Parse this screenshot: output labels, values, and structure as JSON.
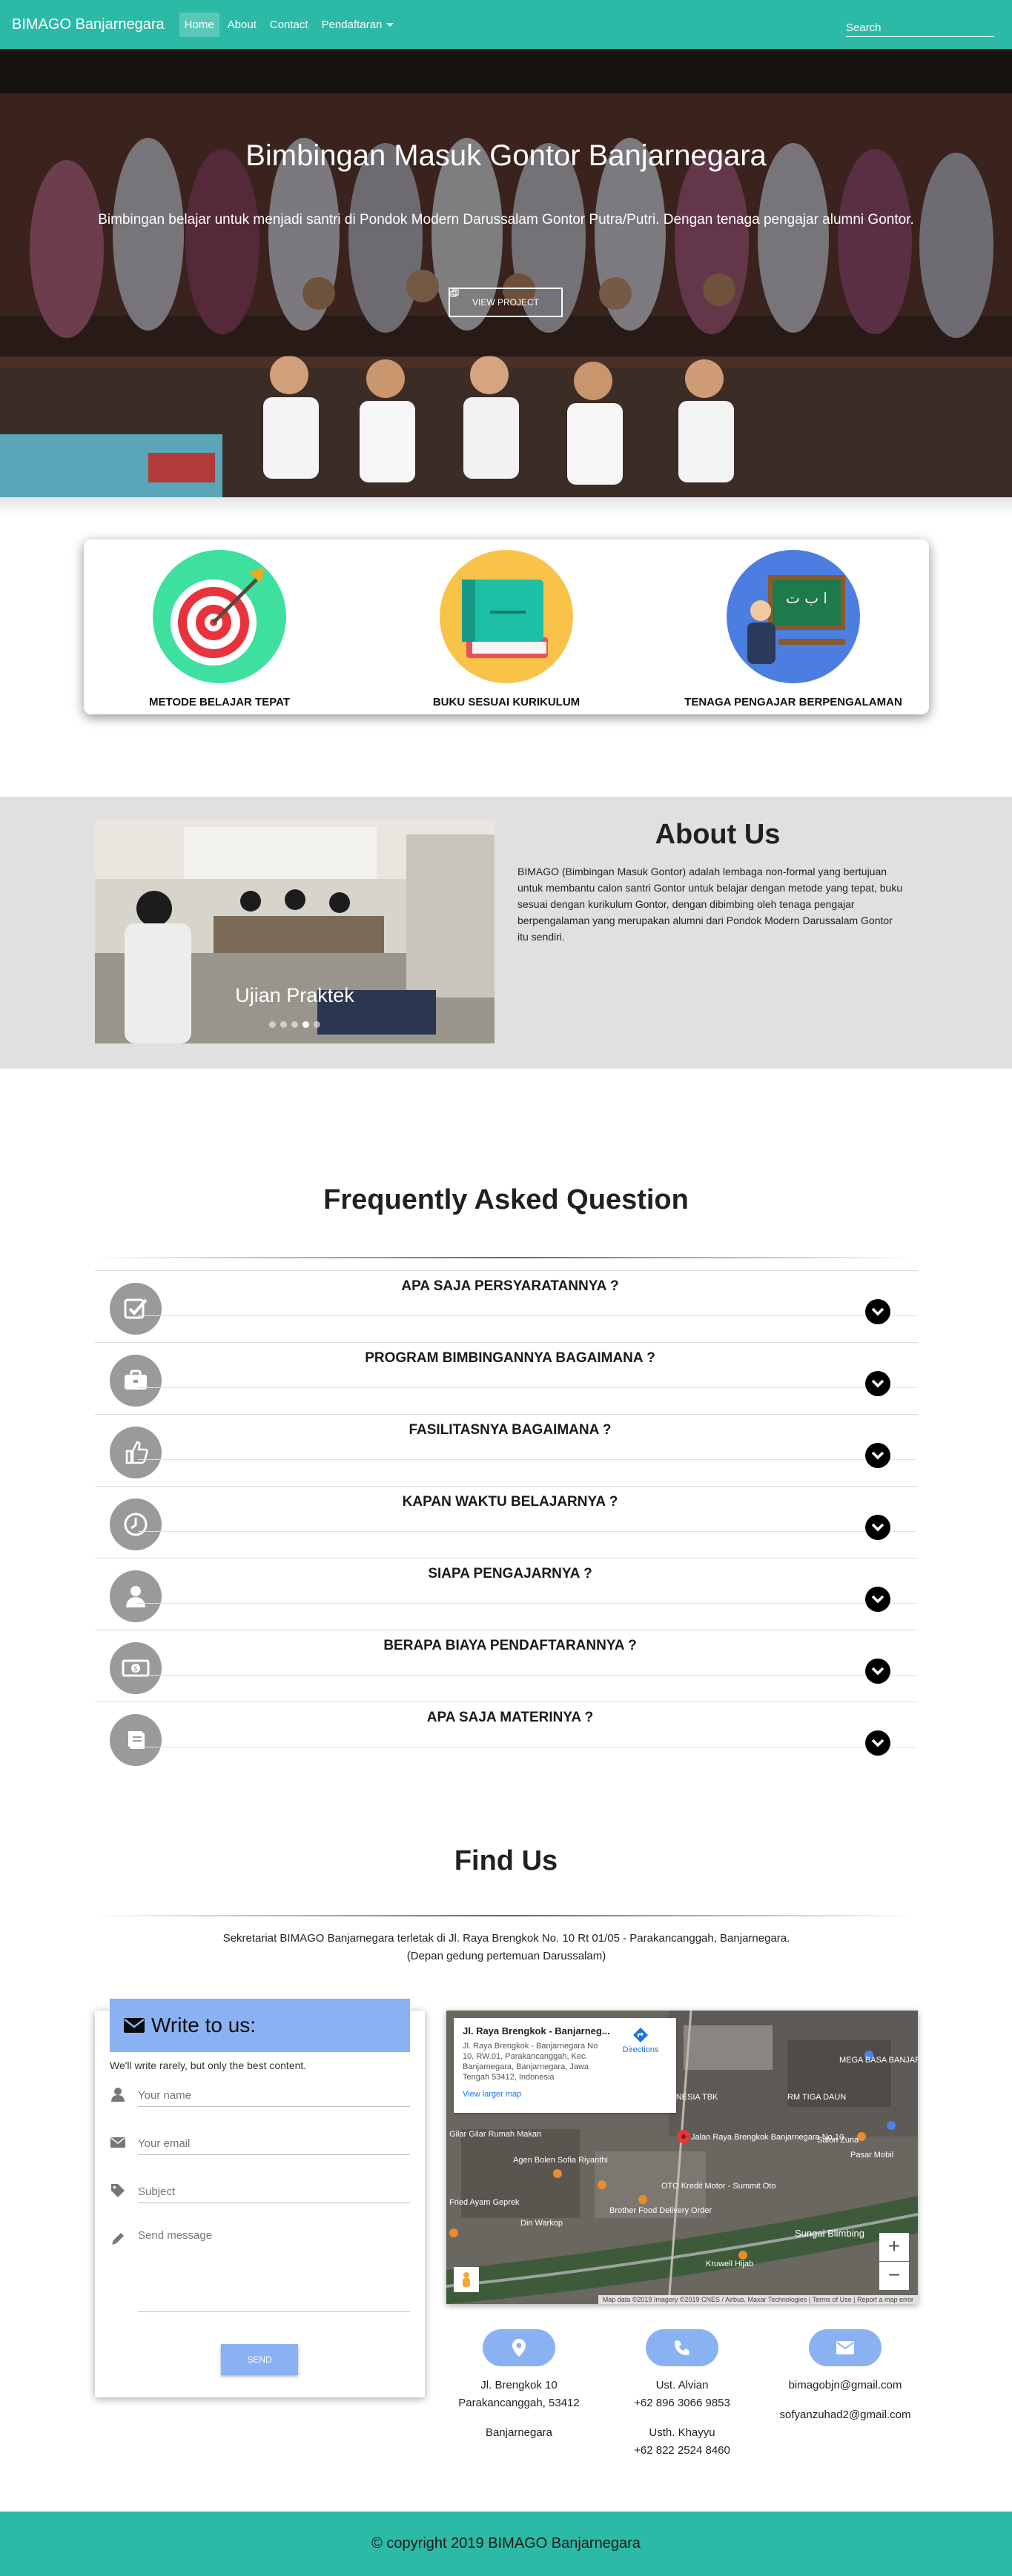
{
  "nav": {
    "brand": "BIMAGO Banjarnegara",
    "links": [
      "Home",
      "About",
      "Contact",
      "Pendaftaran"
    ],
    "search_placeholder": "Search"
  },
  "hero": {
    "title": "Bimbingan Masuk Gontor Banjarnegara",
    "subtitle": "Bimbingan belajar untuk menjadi santri di Pondok Modern Darussalam Gontor Putra/Putri. Dengan tenaga pengajar alumni Gontor.",
    "button": "VIEW PROJECT"
  },
  "features": [
    {
      "label": "METODE BELAJAR TEPAT",
      "icon": "target-icon",
      "color": "#3ee0a0"
    },
    {
      "label": "BUKU SESUAI KURIKULUM",
      "icon": "book-icon",
      "color": "#f9c34a"
    },
    {
      "label": "TENAGA PENGAJAR BERPENGALAMAN",
      "icon": "teacher-icon",
      "color": "#4b7ee0"
    }
  ],
  "about": {
    "carousel_caption": "Ujian Praktek",
    "carousel_slides": 5,
    "carousel_active": 4,
    "title": "About Us",
    "text": "BIMAGO (Bimbingan Masuk Gontor) adalah lembaga non-formal yang bertujuan untuk membantu calon santri Gontor untuk belajar dengan metode yang tepat, buku sesuai dengan kurikulum Gontor, dengan dibimbing oleh tenaga pengajar berpengalaman yang merupakan alumni dari Pondok Modern Darussalam Gontor itu sendiri."
  },
  "faq": {
    "title": "Frequently Asked Question",
    "items": [
      {
        "q": "APA SAJA PERSYARATANNYA ?",
        "icon": "checkbox-icon"
      },
      {
        "q": "PROGRAM BIMBINGANNYA BAGAIMANA ?",
        "icon": "briefcase-icon"
      },
      {
        "q": "FASILITASNYA BAGAIMANA ?",
        "icon": "thumbs-up-icon"
      },
      {
        "q": "KAPAN WAKTU BELAJARNYA ?",
        "icon": "clock-icon"
      },
      {
        "q": "SIAPA PENGAJARNYA ?",
        "icon": "person-icon"
      },
      {
        "q": "BERAPA BIAYA PENDAFTARANNYA ?",
        "icon": "money-icon"
      },
      {
        "q": "APA SAJA MATERINYA ?",
        "icon": "book-icon"
      }
    ]
  },
  "find": {
    "title": "Find Us",
    "text_line1": "Sekretariat BIMAGO Banjarnegara terletak di Jl. Raya Brengkok No. 10 Rt 01/05 - Parakancanggah, Banjarnegara.",
    "text_line2": "(Depan gedung pertemuan Darussalam)"
  },
  "form": {
    "title": "Write to us:",
    "subtitle": "We'll write rarely, but only the best content.",
    "name_placeholder": "Your name",
    "email_placeholder": "Your email",
    "subject_placeholder": "Subject",
    "message_placeholder": "Send message",
    "send": "SEND"
  },
  "map": {
    "place_title": "Jl. Raya Brengkok - Banjarneg...",
    "place_address": "Jl. Raya Brengkok - Banjarnegara No 10, RW.01, Parakancanggah, Kec. Banjarnegara, Banjarnegara, Jawa Tengah 53412, Indonesia",
    "larger_map": "View larger map",
    "directions": "Directions",
    "zoom_in": "+",
    "zoom_out": "−",
    "attribution": "Map data ©2019 Imagery ©2019 CNES / Airbus, Maxar Technologies | Terms of Use | Report a map error",
    "labels": [
      "PT PERMATA FINANCE INDONESIA TBK",
      "Jalan Raya Brengkok Banjarnegara No.10",
      "OTO Kredit Motor - Summit Oto",
      "Agen Bolen Sofia Riyanthi",
      "Brother Food Delivery Order",
      "Din Warkop",
      "Kruwell Hijab",
      "MEGA BASA BANJARNEGA",
      "Salon Zuna",
      "Pasar Mobil",
      "RM TIGA DAUN",
      "Sungai Blimbing",
      "Fried Ayam Geprek",
      "Gilar Gilar Rumah Makan"
    ]
  },
  "contacts": [
    {
      "icon": "location-icon",
      "lines": [
        "Jl. Brengkok 10",
        "Parakancanggah, 53412",
        "",
        "Banjarnegara"
      ]
    },
    {
      "icon": "phone-icon",
      "lines": [
        "Ust. Alvian",
        "+62 896 3066 9853",
        "",
        "Usth. Khayyu",
        "+62 822 2524 8460"
      ]
    },
    {
      "icon": "envelope-icon",
      "lines": [
        "bimagobjn@gmail.com",
        "",
        "sofyanzuhad2@gmail.com"
      ]
    }
  ],
  "footer": {
    "text": "© copyright 2019 BIMAGO Banjarnegara"
  },
  "colors": {
    "primary": "#2cb9a6",
    "accent": "#8ab1f2",
    "about_bg": "#e0e0e0"
  }
}
